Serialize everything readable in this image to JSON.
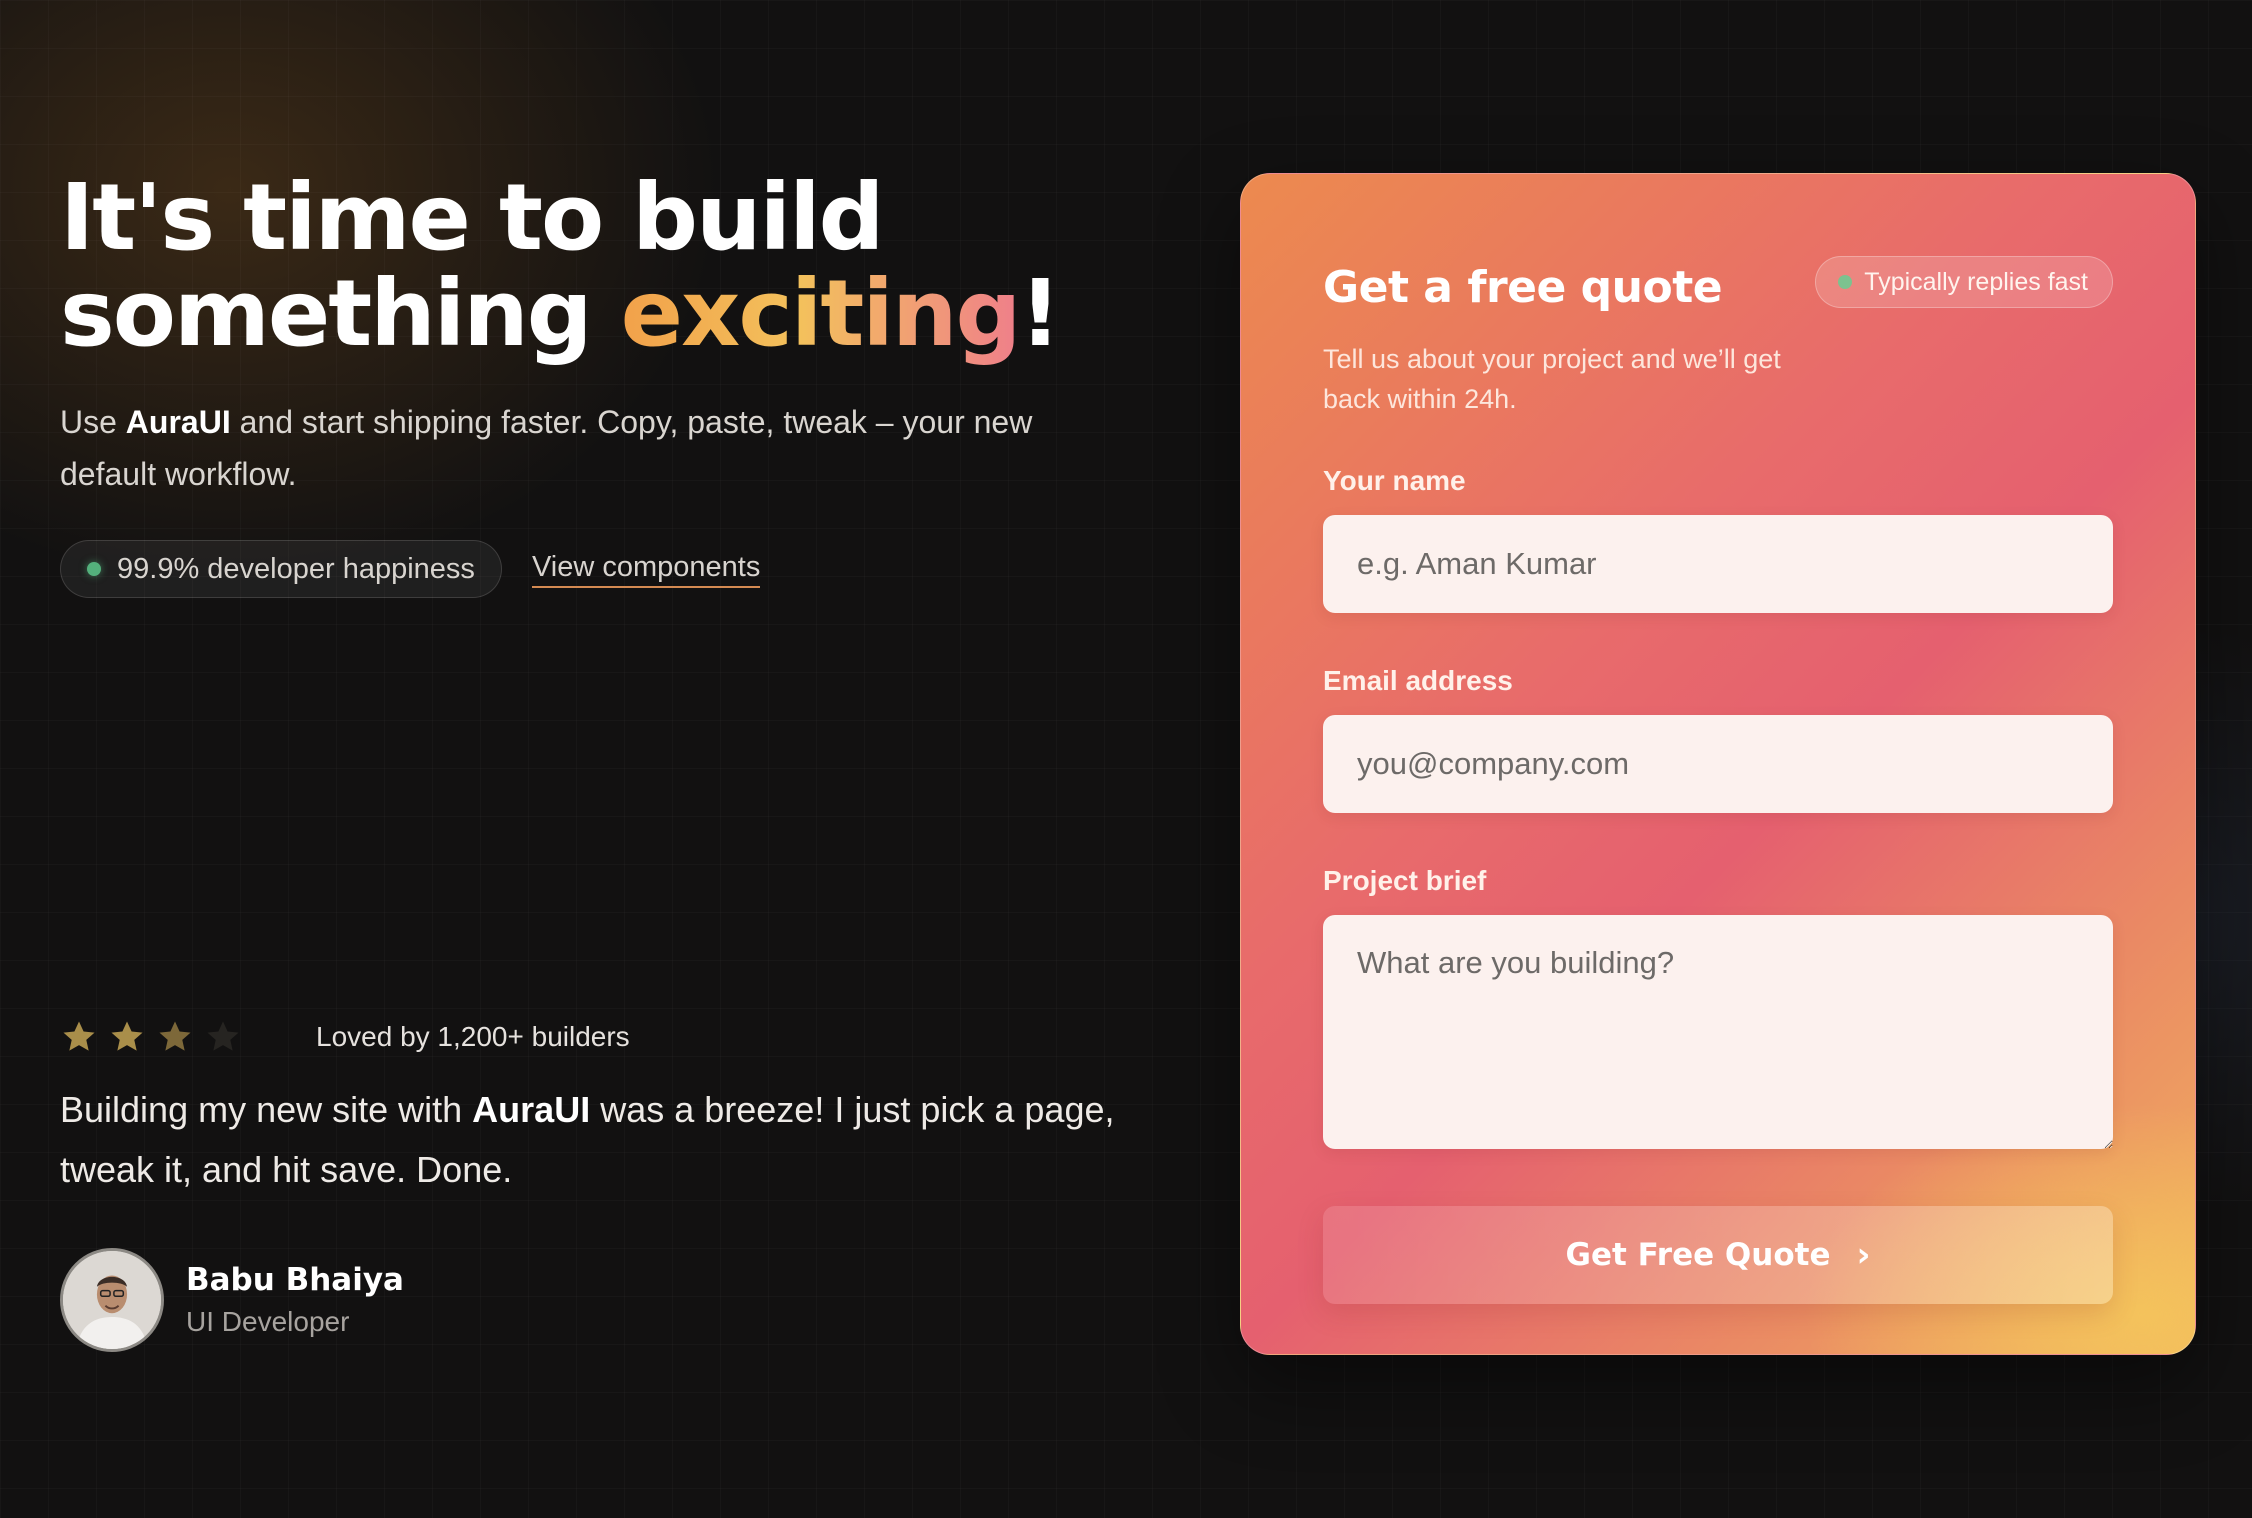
{
  "hero": {
    "headline_line1": "It's time to build",
    "headline_line2_prefix": "something ",
    "headline_accent": "exciting",
    "headline_suffix": "!",
    "subcopy_prefix": "Use ",
    "subcopy_brand": "AuraUI",
    "subcopy_rest": " and start shipping faster. Copy, paste, tweak – your new default workflow.",
    "pill_text": "99.9% developer happiness",
    "link_text": "View components"
  },
  "testimonial": {
    "rating": 3,
    "rating_max": 4,
    "rating_text": "Loved by 1,200+ builders",
    "quote_prefix": "Building my new site with ",
    "quote_brand": "AuraUI",
    "quote_rest": " was a breeze! I just pick a page, tweak it, and hit save. Done.",
    "author_name": "Babu Bhaiya",
    "author_role": "UI Developer"
  },
  "form": {
    "title": "Get a free quote",
    "badge_text": "Typically replies fast",
    "subtitle": "Tell us about your project and we’ll get back within 24h.",
    "name_label": "Your name",
    "name_placeholder": "e.g. Aman Kumar",
    "email_label": "Email address",
    "email_placeholder": "you@company.com",
    "brief_label": "Project brief",
    "brief_placeholder": "What are you building?",
    "submit_label": "Get Free Quote",
    "submit_icon": "chevron-right-icon"
  },
  "colors": {
    "accent_gold": "#f3c15c",
    "accent_pink": "#ef7f8a",
    "status_green": "#54b07c",
    "background": "#121111",
    "star_filled": "#c4a455",
    "star_empty": "#3a3832"
  }
}
